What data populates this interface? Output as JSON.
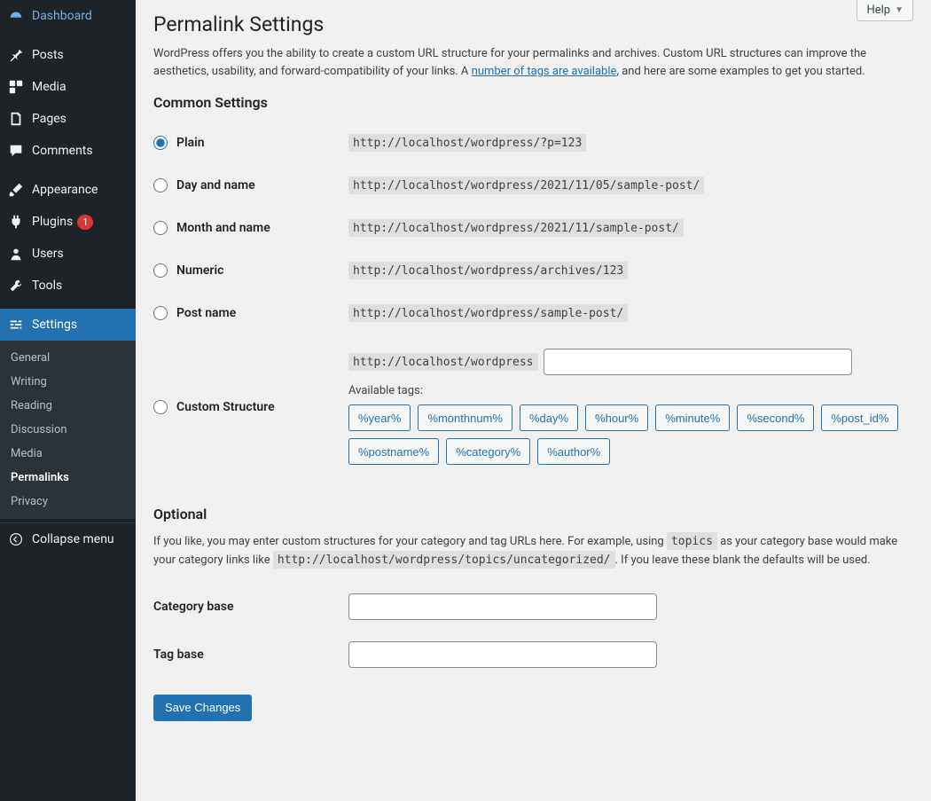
{
  "sidebar": {
    "items": [
      {
        "label": "Dashboard",
        "icon": "dashboard"
      },
      {
        "label": "Posts",
        "icon": "pin"
      },
      {
        "label": "Media",
        "icon": "media"
      },
      {
        "label": "Pages",
        "icon": "pages"
      },
      {
        "label": "Comments",
        "icon": "comment"
      },
      {
        "label": "Appearance",
        "icon": "brush"
      },
      {
        "label": "Plugins",
        "icon": "plug",
        "badge": "1"
      },
      {
        "label": "Users",
        "icon": "user"
      },
      {
        "label": "Tools",
        "icon": "wrench"
      },
      {
        "label": "Settings",
        "icon": "sliders",
        "active": true
      }
    ],
    "submenu": [
      "General",
      "Writing",
      "Reading",
      "Discussion",
      "Media",
      "Permalinks",
      "Privacy"
    ],
    "submenu_current": "Permalinks",
    "collapse": "Collapse menu"
  },
  "help": "Help",
  "page": {
    "title": "Permalink Settings",
    "intro_1": "WordPress offers you the ability to create a custom URL structure for your permalinks and archives. Custom URL structures can improve the aesthetics, usability, and forward-compatibility of your links. A ",
    "intro_link": "number of tags are available",
    "intro_2": ", and here are some examples to get you started.",
    "common_heading": "Common Settings",
    "options": [
      {
        "label": "Plain",
        "code": "http://localhost/wordpress/?p=123",
        "checked": true
      },
      {
        "label": "Day and name",
        "code": "http://localhost/wordpress/2021/11/05/sample-post/"
      },
      {
        "label": "Month and name",
        "code": "http://localhost/wordpress/2021/11/sample-post/"
      },
      {
        "label": "Numeric",
        "code": "http://localhost/wordpress/archives/123"
      },
      {
        "label": "Post name",
        "code": "http://localhost/wordpress/sample-post/"
      }
    ],
    "custom_label": "Custom Structure",
    "custom_prefix": "http://localhost/wordpress",
    "custom_value": "",
    "available_tags_label": "Available tags:",
    "tags": [
      "%year%",
      "%monthnum%",
      "%day%",
      "%hour%",
      "%minute%",
      "%second%",
      "%post_id%",
      "%postname%",
      "%category%",
      "%author%"
    ],
    "optional_heading": "Optional",
    "optional_1": "If you like, you may enter custom structures for your category and tag URLs here. For example, using ",
    "optional_code1": "topics",
    "optional_2": " as your category base would make your category links like ",
    "optional_code2": "http://localhost/wordpress/topics/uncategorized/",
    "optional_3": ". If you leave these blank the defaults will be used.",
    "category_base_label": "Category base",
    "category_base_value": "",
    "tag_base_label": "Tag base",
    "tag_base_value": "",
    "save": "Save Changes"
  }
}
